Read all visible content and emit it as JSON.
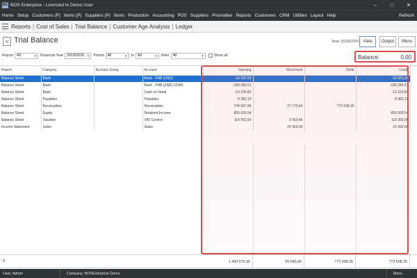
{
  "window": {
    "app_icon": "BE",
    "title": "BOS Enterprise - Licensed to Demo User",
    "minimize": "–",
    "maximize": "□",
    "close": "✕"
  },
  "menu": {
    "items": [
      "Home",
      "Setup",
      "Customers (P)",
      "Items (P)",
      "Suppliers (P)",
      "Items",
      "Production",
      "Accounting",
      "POS",
      "Suppliers",
      "Prismaflex",
      "Reports",
      "Customers",
      "CRM",
      "Utilities",
      "Layout",
      "Help"
    ],
    "refresh": "Refresh"
  },
  "breadcrumb": [
    "Reports",
    "Cost of Sales",
    "Trial Balance",
    "Customer Age Analysis",
    "Ledger"
  ],
  "breadcrumb_sep": "|",
  "header": {
    "back": "<",
    "title": "Trial Balance",
    "year_label": "Year: 2019/2020",
    "view": "View",
    "output": "Output",
    "menu": "Menu"
  },
  "filters": {
    "report_label": "Report",
    "report_value": "All",
    "fy_label": "Financial Year",
    "fy_value": "2019/2020",
    "period_label": "Period",
    "period_value": "All",
    "to_label": "to",
    "to_value": "All",
    "filter_label": "Filter",
    "filter_value": "All",
    "show_all": "Show all",
    "dropdown_glyph": "▾"
  },
  "balance": {
    "label": "Balance",
    "value": "0,00"
  },
  "grid": {
    "headers": [
      "Report",
      "Category",
      "Account Group",
      "Account",
      "Opening",
      "Movement",
      "Debit",
      "Credit"
    ],
    "rows": [
      [
        "Balance Sheet",
        "Bank",
        "",
        "Bank - FNB (USD)",
        "-16 920,05",
        "",
        "",
        "-16 920,05"
      ],
      [
        "Balance Sheet",
        "Bank",
        "",
        "Bank - FNB (ZAR) 12345",
        "-199 280,51",
        "",
        "",
        "-199 280,51"
      ],
      [
        "Balance Sheet",
        "Bank",
        "",
        "Cash on Hand",
        "-13 225,82",
        "",
        "",
        "-13 225,82"
      ],
      [
        "Balance Sheet",
        "Payables",
        "",
        "Payables",
        "8 382,19",
        "",
        "",
        "8 382,19"
      ],
      [
        "Balance Sheet",
        "Receivables",
        "",
        "Receivables",
        "744 837,95",
        "27 770,40",
        "772 608,35",
        ""
      ],
      [
        "Balance Sheet",
        "Equity",
        "",
        "Retained Income",
        "850 939,54",
        "",
        "",
        "850 939,54"
      ],
      [
        "Balance Sheet",
        "Taxation",
        "",
        "VAT Control",
        "114 952,60",
        "3 410,40",
        "",
        "118 363,00"
      ],
      [
        "Income Statement",
        "Sales",
        "",
        "Sales",
        "",
        "24 360,00",
        "",
        "24 360,00"
      ]
    ]
  },
  "totals": {
    "count": "8",
    "opening": "1 493 675,90",
    "movement": "55 540,80",
    "debit": "772 608,35",
    "credit": "772 608,35"
  },
  "status": {
    "user": "User: Admin",
    "company": "Company: BOSEnterprise Demo",
    "menu": "Menu"
  },
  "colors": {
    "chrome": "#2f3437",
    "selection": "#1f6fd1",
    "highlight": "#d84a4a"
  }
}
